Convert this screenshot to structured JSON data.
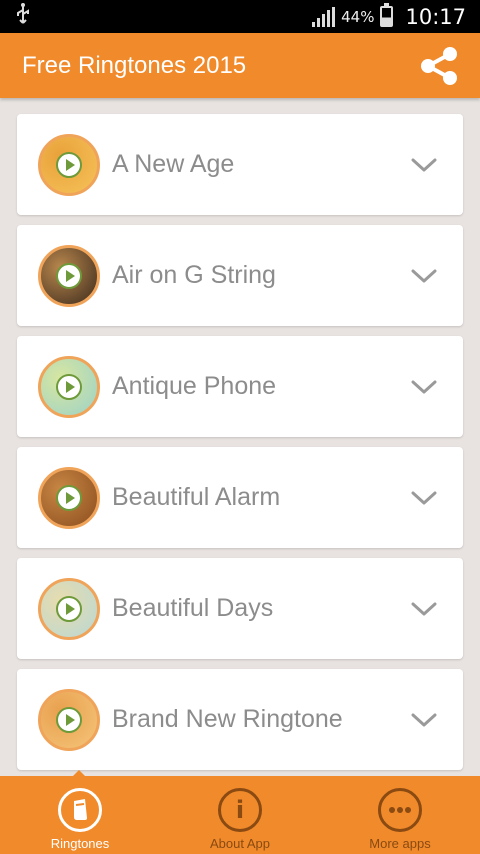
{
  "status_bar": {
    "usb_icon": "usb-icon",
    "battery_percent": "44%",
    "time": "10:17"
  },
  "app_bar": {
    "title": "Free Ringtones 2015",
    "share_icon": "share-icon"
  },
  "ringtones": [
    {
      "title": "A New Age",
      "thumb_colors": [
        "#f6c35a",
        "#e9a13a"
      ]
    },
    {
      "title": "Air on G String",
      "thumb_colors": [
        "#3b2a1c",
        "#b9874d"
      ]
    },
    {
      "title": "Antique Phone",
      "thumb_colors": [
        "#9cd2c8",
        "#d8e6a0"
      ]
    },
    {
      "title": "Beautiful Alarm",
      "thumb_colors": [
        "#8b4d1e",
        "#c88744"
      ]
    },
    {
      "title": "Beautiful Days",
      "thumb_colors": [
        "#b9d8d4",
        "#e8dcae"
      ]
    },
    {
      "title": "Brand New Ringtone",
      "thumb_colors": [
        "#f5c57a",
        "#e8a04e"
      ]
    }
  ],
  "bottom_nav": {
    "items": [
      {
        "label": "Ringtones",
        "icon": "ringtone-icon",
        "active": true
      },
      {
        "label": "About App",
        "icon": "info-icon",
        "active": false
      },
      {
        "label": "More apps",
        "icon": "more-icon",
        "active": false
      }
    ]
  },
  "colors": {
    "accent": "#f08a2a",
    "nav_inactive": "#8a4a12"
  }
}
